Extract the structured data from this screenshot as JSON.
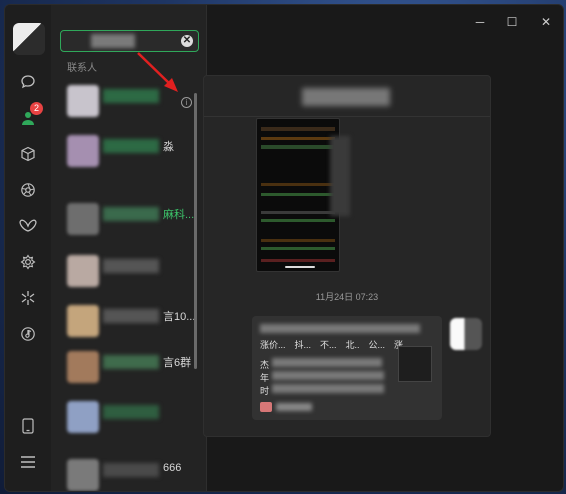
{
  "window_controls": {
    "minimize": "─",
    "maximize": "☐",
    "close": "✕"
  },
  "iconbar": {
    "contacts_badge": "2",
    "icons": [
      "chat-icon",
      "contacts-icon",
      "box-icon",
      "aperture-icon",
      "butterfly-icon",
      "gear-flower-icon",
      "sparkle-icon",
      "music-icon",
      "phone-icon",
      "menu-icon"
    ]
  },
  "contacts": {
    "section_label": "联系人",
    "clear_glyph": "✕",
    "info_glyph": "i",
    "items": [
      {
        "tail": ""
      },
      {
        "tail": "淼"
      },
      {
        "tail": "麻科..."
      },
      {
        "tail": ""
      },
      {
        "tail": "言10..."
      },
      {
        "tail": "言6群"
      },
      {
        "tail": ""
      },
      {
        "tail": "666"
      }
    ]
  },
  "chat": {
    "timestamp": "11月24日 07:23",
    "card_text_line2": "涨价...　抖...　不...　北..　公...　涨",
    "card_text_line3": "杰",
    "card_text_line4": "年",
    "card_text_line5": "时"
  },
  "colors": {
    "accent": "#2fa85a",
    "badge": "#e84343",
    "arrow": "#e02020"
  }
}
